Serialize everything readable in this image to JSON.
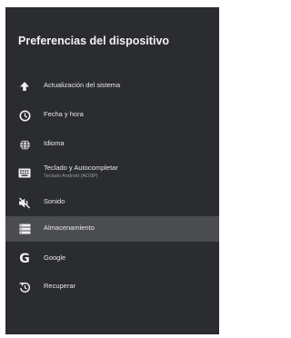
{
  "screen": {
    "title": "Preferencias del dispositivo",
    "selected_index": 5
  },
  "items": [
    {
      "label": "Actualización del sistema",
      "sublabel": "",
      "icon": "arrow-up-icon"
    },
    {
      "label": "Fecha y hora",
      "sublabel": "",
      "icon": "clock-icon"
    },
    {
      "label": "Idioma",
      "sublabel": "",
      "icon": "globe-icon"
    },
    {
      "label": "Teclado y Autocompletar",
      "sublabel": "Teclado Android (AOSP)",
      "icon": "keyboard-icon"
    },
    {
      "label": "Sonido",
      "sublabel": "",
      "icon": "speaker-muted-icon"
    },
    {
      "label": "Almacenamiento",
      "sublabel": "",
      "icon": "storage-icon"
    },
    {
      "label": "Google",
      "sublabel": "",
      "icon": "google-g-icon"
    },
    {
      "label": "Recuperar",
      "sublabel": "",
      "icon": "restore-icon"
    }
  ],
  "colors": {
    "panel_bg": "#2a2c2f",
    "selected_bg": "#4a4c50",
    "text": "#e8e8e8"
  }
}
